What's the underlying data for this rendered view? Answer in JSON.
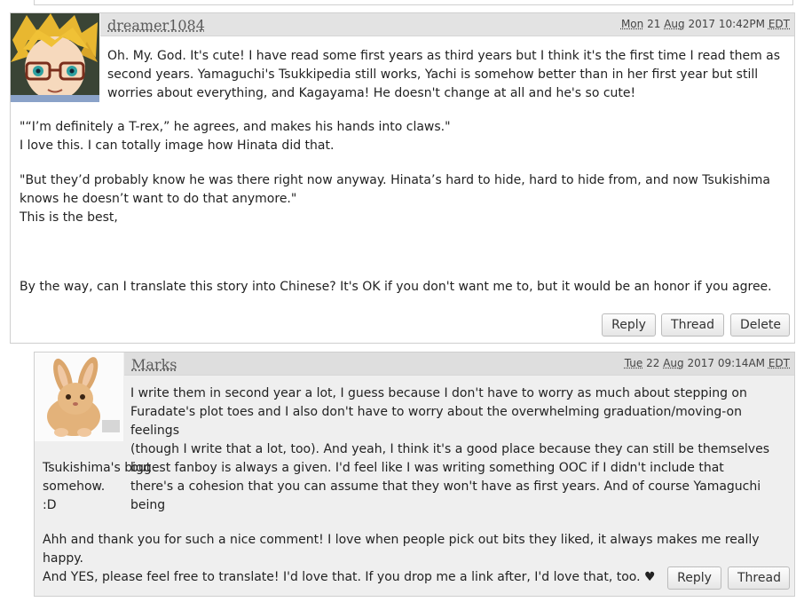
{
  "comment1": {
    "username": "dreamer1084",
    "date": {
      "day": "Mon",
      "date": "21",
      "month": "Aug",
      "year": "2017",
      "time": "10:42PM",
      "tz": "EDT"
    },
    "lines": [
      "Oh. My. God. It's cute! I have read some first years as third years but I think it's the first time I read them as",
      "second years. Yamaguchi's Tsukkipedia still works, Yachi is somehow better than in her first year but still",
      "worries about everything, and Kagayama! He doesn't change at all and he's so cute!",
      "\"“I’m definitely a T-rex,” he agrees, and makes his hands into claws.\"",
      "I love this. I can totally image how Hinata did that.",
      "\"But they’d probably know he was there right now anyway. Hinata’s hard to hide, hard to hide from, and now Tsukishima",
      "knows he doesn’t want to do that anymore.\"",
      "This is the best,",
      "By the way, can I translate this story into Chinese? It's OK if you don't want me to, but it would be an honor if you agree."
    ],
    "buttons": {
      "reply": "Reply",
      "thread": "Thread",
      "delete": "Delete"
    }
  },
  "comment2": {
    "username": "Marks",
    "date": {
      "day": "Tue",
      "date": "22",
      "month": "Aug",
      "year": "2017",
      "time": "09:14AM",
      "tz": "EDT"
    },
    "lines": [
      "I write them in second year a lot, I guess because I don't have to worry as much about stepping on",
      "Furadate's plot toes and I also don't have to worry about the overwhelming graduation/moving-on feelings",
      "(though I write that a lot, too). And yeah, I think it's a good place because they can still be themselves but",
      "there's a cohesion that you can assume that they won't have as first years. And of course Yamaguchi being",
      "Tsukishima's biggest fanboy is always a given. I'd feel like I was writing something OOC if I didn't include that somehow.",
      ":D",
      "Ahh and thank you for such a nice comment! I love when people pick out bits they liked, it always makes me really happy.",
      "And YES, please feel free to translate! I'd love that. If you drop me a link after, I'd love that, too. ♥"
    ],
    "buttons": {
      "reply": "Reply",
      "thread": "Thread"
    }
  }
}
